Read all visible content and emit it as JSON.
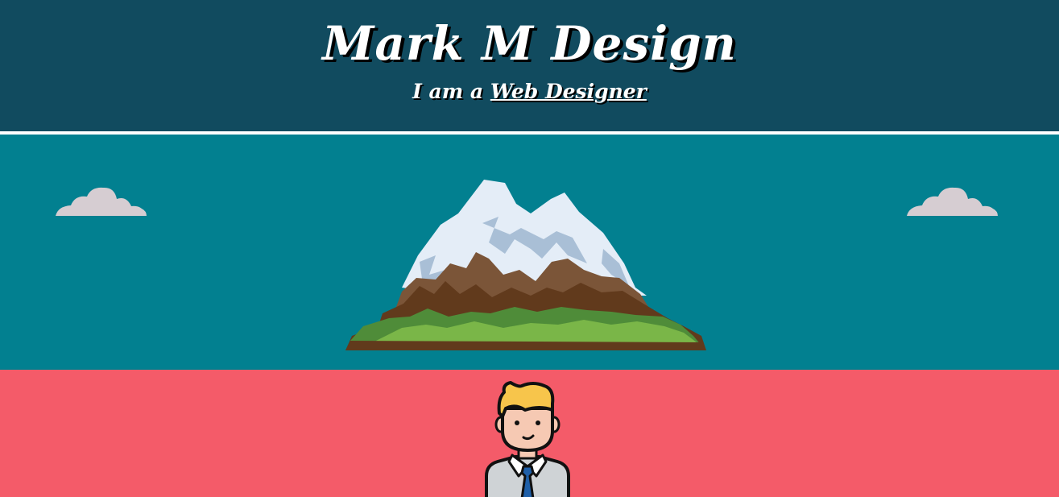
{
  "header": {
    "title": "Mark M Design",
    "tagline_prefix": "I am a ",
    "tagline_link": "Web Designer"
  },
  "colors": {
    "header_bg": "#114b5f",
    "sky_bg": "#028090",
    "pink_bg": "#f45b69",
    "cloud": "#d6cdd2",
    "snow": "#e4edf7",
    "rock_light": "#7b5538",
    "rock_dark": "#613a1c",
    "grass_dark": "#4f8c39",
    "grass_light": "#7ab648"
  },
  "icons": {
    "cloud_left": "cloud-icon",
    "cloud_right": "cloud-icon",
    "mountain": "mountain-island-illustration",
    "avatar": "businessman-avatar-illustration"
  }
}
